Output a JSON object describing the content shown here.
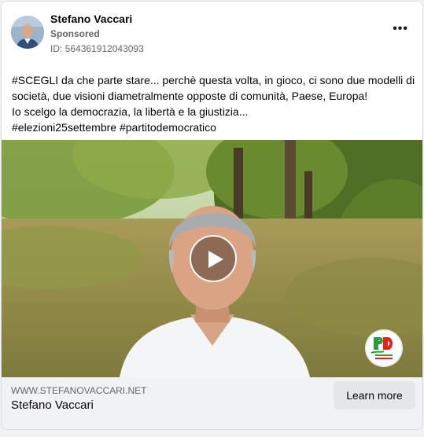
{
  "ad": {
    "advertiser_name": "Stefano Vaccari",
    "sponsored_label": "Sponsored",
    "ad_id": "ID: 564361912043093",
    "body_lines": [
      "#SCEGLI da che parte stare... perchè questa volta, in gioco, ci sono due modelli di",
      "società, due visioni diametralmente opposte di comunità, Paese, Europa!",
      "Io scelgo la democrazia, la libertà e la giustizia...",
      "#elezioni25settembre #partitodemocratico"
    ],
    "more_icon": "more-options-icon",
    "media": {
      "type": "video",
      "play_icon": "play-icon",
      "logo_icon": "pd-party-logo"
    }
  },
  "footer": {
    "domain": "WWW.STEFANOVACCARI.NET",
    "title": "Stefano Vaccari",
    "cta_label": "Learn more"
  },
  "colors": {
    "card_bg": "#ffffff",
    "footer_bg": "#f0f2f5",
    "cta_bg": "#e4e6eb",
    "secondary_text": "#65676b"
  }
}
